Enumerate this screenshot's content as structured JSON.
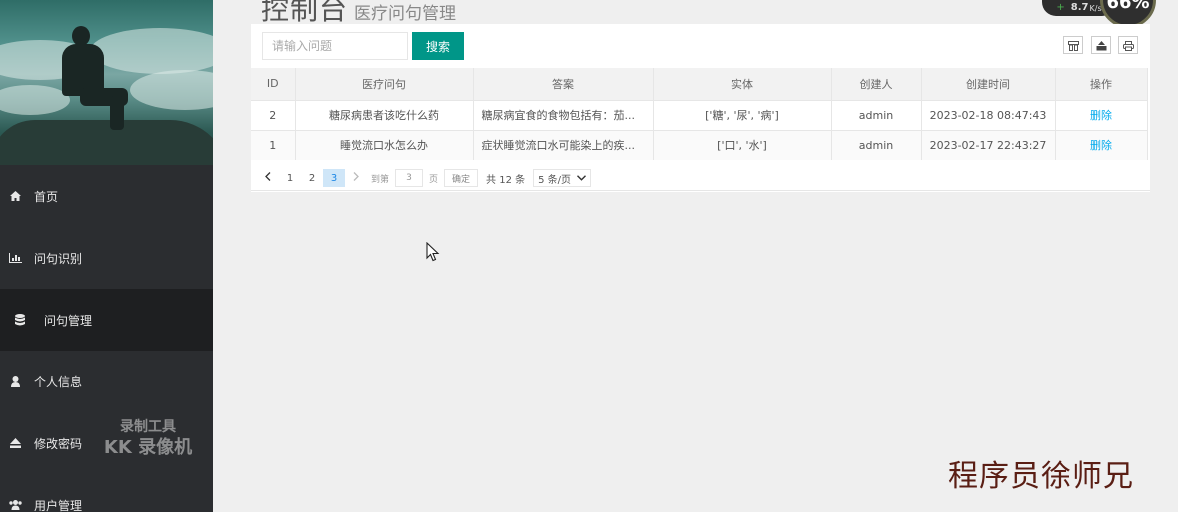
{
  "header": {
    "title": "控制台",
    "subtitle": "医疗问句管理"
  },
  "recorder": {
    "speed_value": "8.7",
    "speed_unit": "K/s",
    "gauge_text": "66%"
  },
  "sidebar": {
    "items": [
      {
        "label": "首页",
        "icon": "home-icon"
      },
      {
        "label": "问句识别",
        "icon": "bar-chart-icon"
      },
      {
        "label": "问句管理",
        "icon": "database-icon"
      },
      {
        "label": "个人信息",
        "icon": "user-icon"
      },
      {
        "label": "修改密码",
        "icon": "eject-icon"
      },
      {
        "label": "用户管理",
        "icon": "users-icon"
      }
    ],
    "active_index": 2
  },
  "watermark_tool": {
    "line1": "录制工具",
    "line2": "KK 录像机"
  },
  "toolbar": {
    "search_placeholder": "请输入问题",
    "search_label": "搜索",
    "tools": [
      "columns-icon",
      "export-icon",
      "print-icon"
    ]
  },
  "table": {
    "headers": [
      "ID",
      "医疗问句",
      "答案",
      "实体",
      "创建人",
      "创建时间",
      "操作"
    ],
    "rows": [
      {
        "id": "2",
        "question": "糖尿病患者该吃什么药",
        "answer": "糖尿病宜食的食物包括有：茄...",
        "entity": "['糖', '尿', '病']",
        "creator": "admin",
        "created": "2023-02-18 08:47:43",
        "action": "删除"
      },
      {
        "id": "1",
        "question": "睡觉流口水怎么办",
        "answer": "症状睡觉流口水可能染上的疾...",
        "entity": "['口', '水']",
        "creator": "admin",
        "created": "2023-02-17 22:43:27",
        "action": "删除"
      }
    ]
  },
  "pager": {
    "pages": [
      "1",
      "2",
      "3"
    ],
    "current": "3",
    "goto_label": "到第",
    "goto_value": "3",
    "page_unit": "页",
    "confirm_label": "确定",
    "total_label": "共 12 条",
    "limit_label": "5 条/页"
  },
  "brand_watermark": "程序员徐师兄"
}
